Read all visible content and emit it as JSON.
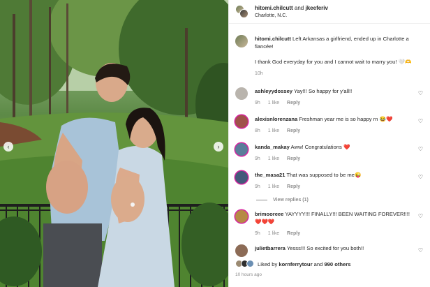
{
  "post": {
    "author": "hitomi.chilcutt",
    "connector": "and",
    "coauthor": "jkeeferiv",
    "location": "Charlotte, N.C."
  },
  "photo": {
    "prev_glyph": "‹",
    "next_glyph": "›"
  },
  "caption": {
    "username": "hitomi.chilcutt",
    "line1": "Left Arkansas a girlfriend, ended up in Charlotte a fiancée!",
    "line2": "I thank God everyday for you and I cannot wait to marry you! 🤍🫶",
    "time": "10h"
  },
  "comments": [
    {
      "username": "ashleyydossey",
      "text": "Yay!!! So happy for y'all!!",
      "time": "9h",
      "likes": "1 like",
      "reply": "Reply",
      "avatar_color": "#b9b4ad"
    },
    {
      "username": "alexisnlorenzana",
      "text": "Freshman year me is so happy rn 😂❤️",
      "time": "8h",
      "likes": "1 like",
      "reply": "Reply",
      "avatar_color": "#a0524a"
    },
    {
      "username": "kanda_makay",
      "text": "Aww! Congratulations ❤️",
      "time": "9h",
      "likes": "1 like",
      "reply": "Reply",
      "avatar_color": "#5a7d9a"
    },
    {
      "username": "the_masa21",
      "text": "That was supposed to be me😜",
      "time": "9h",
      "likes": "1 like",
      "reply": "Reply",
      "avatar_color": "#44597a"
    },
    {
      "username": "brimooreee",
      "text": "YAYYYY!!! FINALLY!!! BEEN WAITING FOREVER!!!!❤️❤️❤️",
      "time": "9h",
      "likes": "1 like",
      "reply": "Reply",
      "avatar_color": "#b68a45"
    },
    {
      "username": "julietbarrera",
      "text": "Yesss!!! So excited for you both!!",
      "time": "",
      "likes": "",
      "reply": "",
      "avatar_color": "#8c6b56"
    }
  ],
  "view_replies": "View replies (1)",
  "likes": {
    "prefix": "Liked by",
    "user": "kornferrytour",
    "middle": "and",
    "count": "990 others"
  },
  "timestamp": "10 hours ago",
  "icons": {
    "heart": "heart-outline-icon",
    "prev": "chevron-left-icon",
    "next": "chevron-right-icon"
  },
  "colors": {
    "meta_gray": "#8e8e8e",
    "text": "#262626",
    "story_ring": "#d6249f"
  }
}
